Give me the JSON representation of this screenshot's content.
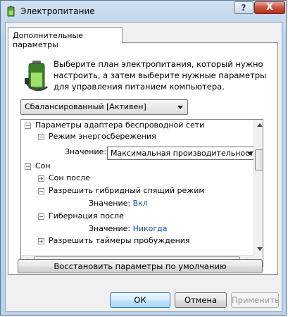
{
  "window": {
    "title": "Электропитание",
    "help_glyph": "?",
    "close_glyph": "X"
  },
  "tab": {
    "label": "Дополнительные параметры"
  },
  "description": "Выберите план электропитания, который нужно настроить, а затем выберите нужные параметры для управления питанием компьютера.",
  "plan_select": {
    "value": "Сбалансированный [Активен]"
  },
  "tree": {
    "items": [
      {
        "label": "Параметры адаптера беспроводной сети",
        "expander": "−"
      },
      {
        "label": "Режим энергосбережения",
        "expander": "−"
      },
      {
        "label": "Значение:"
      },
      {
        "label": "Сон",
        "expander": "−"
      },
      {
        "label": "Сон после",
        "expander": "+"
      },
      {
        "label": "Разрешить гибридный спящий режим",
        "expander": "−"
      },
      {
        "label": "Значение:",
        "value": "Вкл"
      },
      {
        "label": "Гибернация после",
        "expander": "−"
      },
      {
        "label": "Значение:",
        "value": "Никогда"
      },
      {
        "label": "Разрешить таймеры пробуждения",
        "expander": "+"
      }
    ],
    "power_mode_select": "Максимальная производительность"
  },
  "buttons": {
    "restore": "Восстановить параметры по умолчанию",
    "ok": "ОК",
    "cancel": "Отмена",
    "apply": "Применить"
  },
  "colors": {
    "title_bar": "#b9d1ea",
    "close_button": "#c9503c",
    "link_value": "#1a4ea8",
    "default_button_border": "#3c7fb1"
  }
}
